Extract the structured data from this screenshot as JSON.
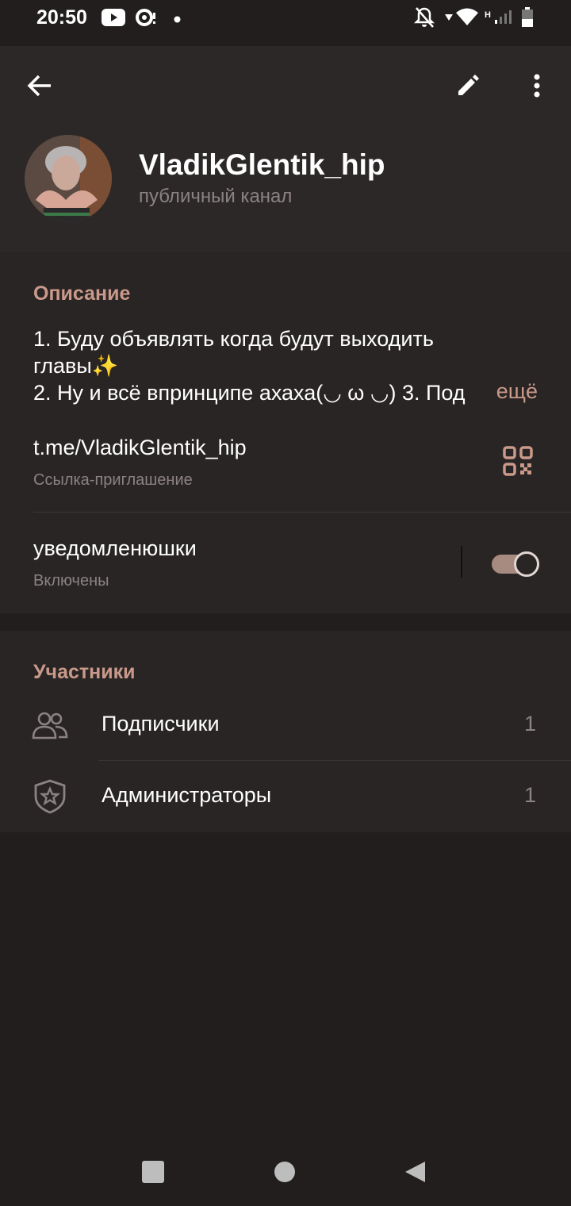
{
  "status_bar": {
    "time": "20:50",
    "network_label": "H"
  },
  "header": {
    "channel_name": "VladikGlentik_hip",
    "channel_type": "публичный канал"
  },
  "info": {
    "description_title": "Описание",
    "description_line1": "1. Буду объявлять когда будут выходить",
    "description_line2": "главы✨",
    "description_line3": "2. Ну и всё впринципе ахаха(◡ ω ◡) 3. Под",
    "more_label": "ещё",
    "link": "t.me/VladikGlentik_hip",
    "link_caption": "Ссылка-приглашение",
    "notifications_title": "уведомленюшки",
    "notifications_status": "Включены",
    "notifications_enabled": true
  },
  "members": {
    "section_title": "Участники",
    "items": [
      {
        "label": "Подписчики",
        "count": "1",
        "icon": "people-icon"
      },
      {
        "label": "Администраторы",
        "count": "1",
        "icon": "shield-star-icon"
      }
    ]
  },
  "colors": {
    "background": "#221e1e",
    "header": "#2d2828",
    "card": "#2a2525",
    "accent": "#c9998a",
    "secondary_text": "#8b8383"
  }
}
